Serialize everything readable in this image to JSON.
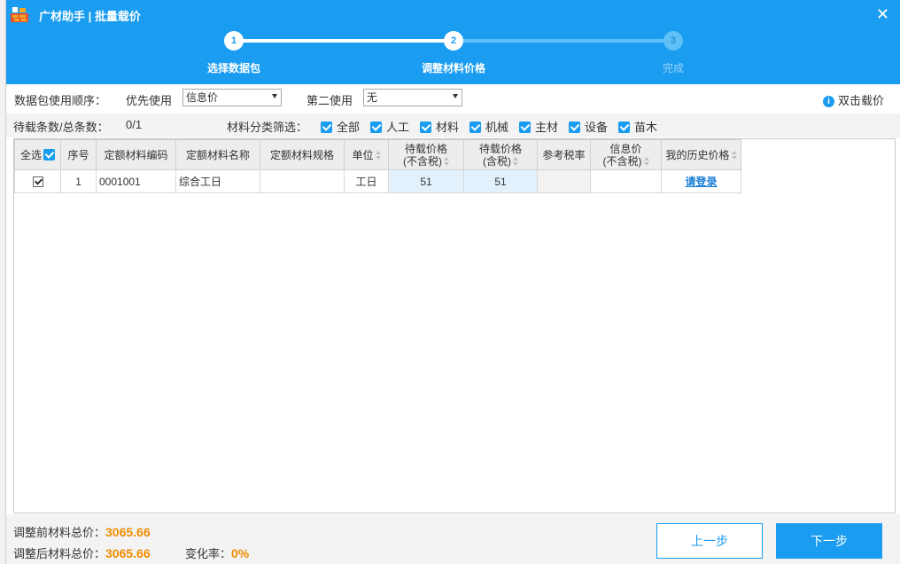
{
  "window": {
    "title": "广材助手 | 批量载价",
    "close_label": "✕"
  },
  "steps": [
    {
      "number": "1",
      "label": "选择数据包",
      "state": "done"
    },
    {
      "number": "2",
      "label": "调整材料价格",
      "state": "active"
    },
    {
      "number": "3",
      "label": "完成",
      "state": "pending"
    }
  ],
  "options": {
    "order_label": "数据包使用顺序：",
    "first_label": "优先使用",
    "first_value": "信息价",
    "second_label": "第二使用",
    "second_value": "无",
    "double_click_label": "双击载价"
  },
  "filters": {
    "count_label": "待载条数/总条数：",
    "count_value": "0/1",
    "category_label": "材料分类筛选：",
    "items": [
      "全部",
      "人工",
      "材料",
      "机械",
      "主材",
      "设备",
      "苗木"
    ]
  },
  "table": {
    "headers": {
      "select_all": "全选",
      "index": "序号",
      "code": "定额材料编码",
      "name": "定额材料名称",
      "spec": "定额材料规格",
      "unit": "单位",
      "price_excl_1": "待载价格",
      "price_excl_2": "(不含税)",
      "price_incl_1": "待载价格",
      "price_incl_2": "(含税)",
      "tax_rate": "参考税率",
      "info_price_1": "信息价",
      "info_price_2": "(不含税)",
      "history": "我的历史价格"
    },
    "rows": [
      {
        "index": "1",
        "code": "0001001",
        "name": "综合工日",
        "spec": "",
        "unit": "工日",
        "price_excl": "51",
        "price_incl": "51",
        "tax_rate": "",
        "info_price": "",
        "history": "请登录"
      }
    ]
  },
  "footer": {
    "before_label": "调整前材料总价：",
    "before_value": "3065.66",
    "after_label": "调整后材料总价：",
    "after_value": "3065.66",
    "rate_label": "变化率：",
    "rate_value": "0%",
    "prev_label": "上一步",
    "next_label": "下一步"
  },
  "colors": {
    "accent": "#1a9cf0",
    "highlight": "#f08c00"
  }
}
